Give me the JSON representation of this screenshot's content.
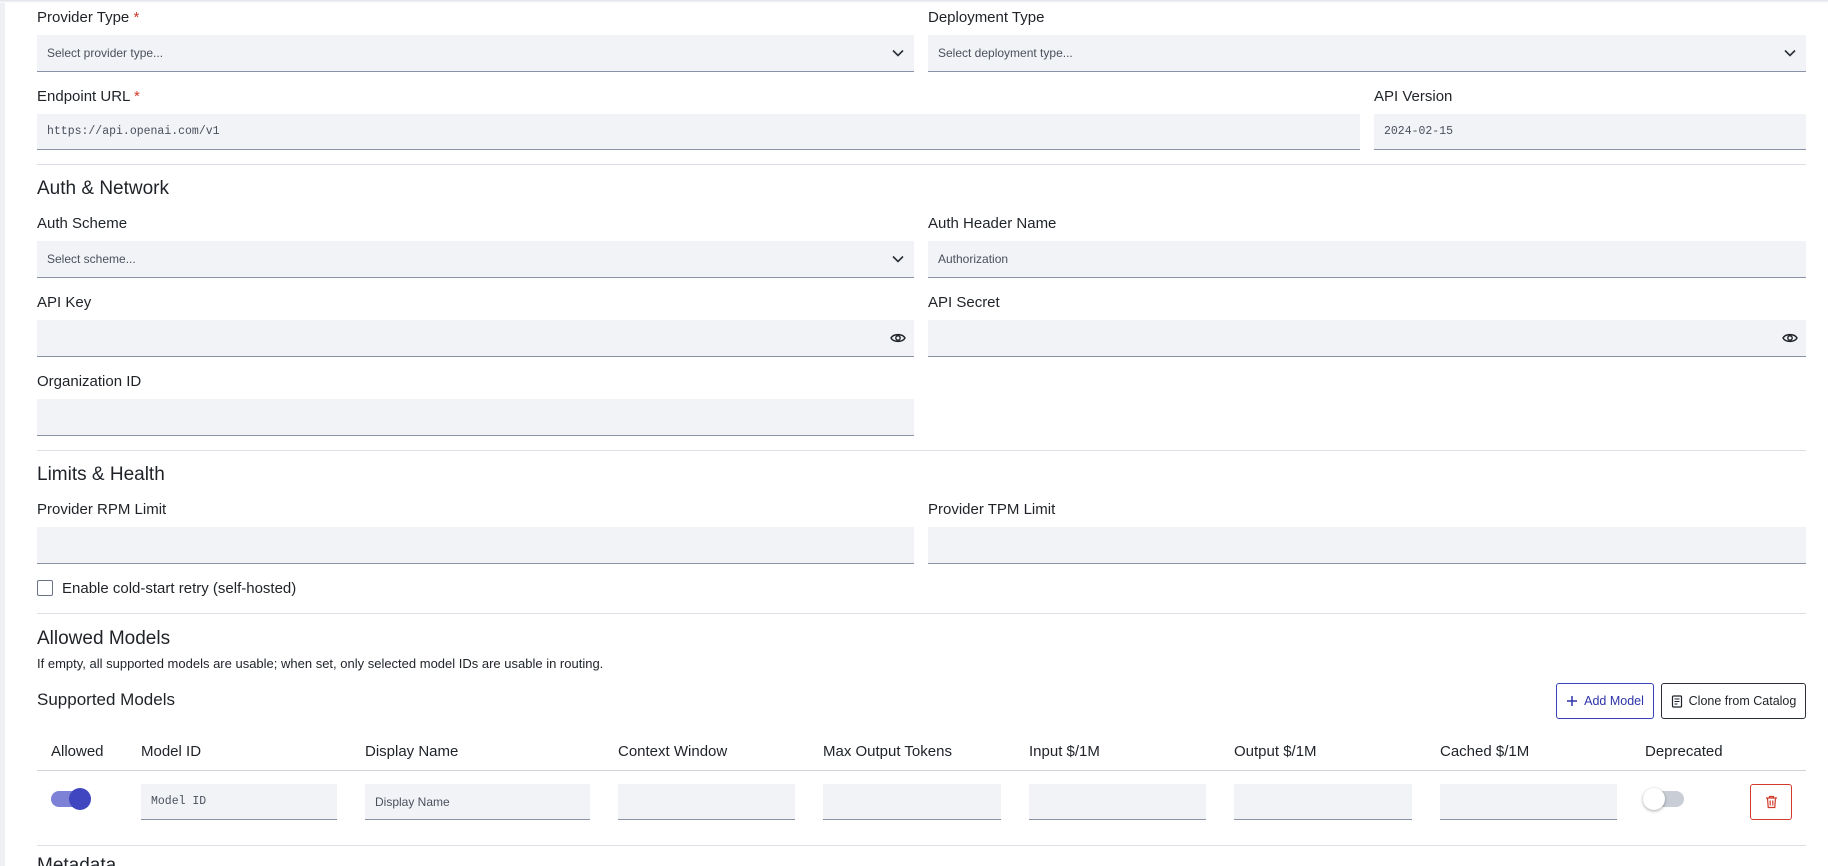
{
  "provider": {
    "provider_type": {
      "label": "Provider Type",
      "required_mark": "*",
      "placeholder": "Select provider type..."
    },
    "deployment_type": {
      "label": "Deployment Type",
      "placeholder": "Select deployment type..."
    },
    "endpoint_url": {
      "label": "Endpoint URL",
      "required_mark": "*",
      "placeholder": "https://api.openai.com/v1"
    },
    "api_version": {
      "label": "API Version",
      "placeholder": "2024-02-15"
    }
  },
  "auth": {
    "title": "Auth & Network",
    "auth_scheme": {
      "label": "Auth Scheme",
      "placeholder": "Select scheme..."
    },
    "auth_header_name": {
      "label": "Auth Header Name",
      "placeholder": "Authorization"
    },
    "api_key": {
      "label": "API Key",
      "value": ""
    },
    "api_secret": {
      "label": "API Secret",
      "value": ""
    },
    "organization_id": {
      "label": "Organization ID",
      "value": ""
    }
  },
  "limits": {
    "title": "Limits & Health",
    "rpm": {
      "label": "Provider RPM Limit",
      "value": ""
    },
    "tpm": {
      "label": "Provider TPM Limit",
      "value": ""
    },
    "cold_start": {
      "label": "Enable cold-start retry (self-hosted)",
      "checked": false
    }
  },
  "allowed_models": {
    "title": "Allowed Models",
    "note": "If empty, all supported models are usable; when set, only selected model IDs are usable in routing."
  },
  "supported_models": {
    "title": "Supported Models",
    "add_label": "Add Model",
    "clone_label": "Clone from Catalog",
    "columns": [
      "Allowed",
      "Model ID",
      "Display Name",
      "Context Window",
      "Max Output Tokens",
      "Input $/1M",
      "Output $/1M",
      "Cached $/1M",
      "Deprecated"
    ],
    "rows": [
      {
        "allowed": true,
        "model_id_placeholder": "Model ID",
        "display_name_placeholder": "Display Name",
        "context_window": "",
        "max_output_tokens": "",
        "input_price": "",
        "output_price": "",
        "cached_price": "",
        "deprecated": false
      }
    ]
  },
  "next_section": {
    "title": "Metadata"
  },
  "colors": {
    "accent": "#3f46c0",
    "danger": "#d23a2c",
    "field_bg": "#f1f3f7"
  },
  "icons": {
    "select": "chevron-down-icon",
    "reveal": "eye-icon",
    "add": "plus-icon",
    "clone": "catalog-icon",
    "delete": "trash-icon"
  }
}
